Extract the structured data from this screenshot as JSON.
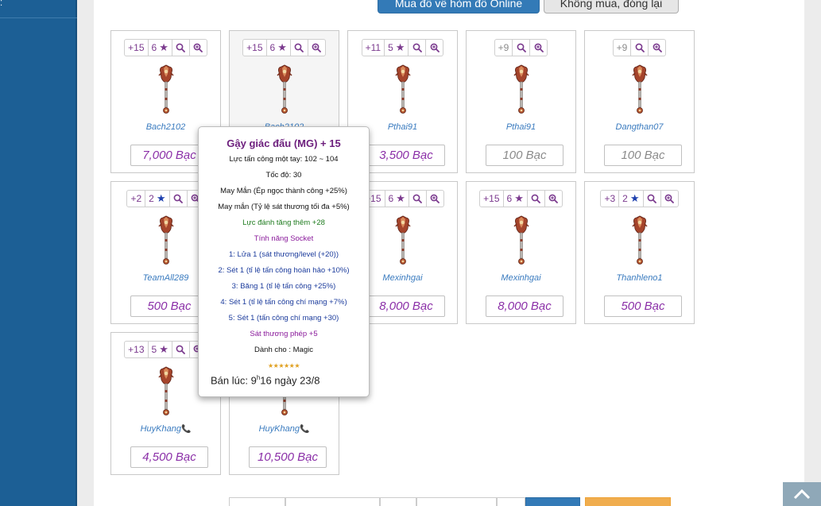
{
  "buttons": {
    "buy": "Mua đồ về hòm đồ Online",
    "cancel": "Không mua, đóng lại"
  },
  "cards": [
    {
      "plus": "+15",
      "stars": "6",
      "seller": "Bach2102",
      "price": "7,000 Bạc"
    },
    {
      "plus": "+15",
      "stars": "6",
      "seller": "Bach2102",
      "price": ""
    },
    {
      "plus": "+11",
      "stars": "5",
      "seller": "Pthai91",
      "price": "3,500 Bạc"
    },
    {
      "plus": "+9",
      "stars": "",
      "seller": "Pthai91",
      "price": "100 Bạc"
    },
    {
      "plus": "+9",
      "stars": "",
      "seller": "Dangthan07",
      "price": "100 Bạc"
    },
    {
      "plus": "+2",
      "stars": "2",
      "seller": "TeamAll289",
      "price": "500 Bạc"
    },
    {
      "plus": "",
      "stars": "",
      "seller": "",
      "price": ""
    },
    {
      "plus": "+15",
      "stars": "6",
      "seller": "Mexinhgai",
      "price": "8,000 Bạc"
    },
    {
      "plus": "+15",
      "stars": "6",
      "seller": "Mexinhgai",
      "price": "8,000 Bạc"
    },
    {
      "plus": "+3",
      "stars": "2",
      "seller": "Thanhleno1",
      "price": "500 Bạc"
    },
    {
      "plus": "+13",
      "stars": "5",
      "seller": "HuyKhang",
      "price": "4,500 Bạc"
    },
    {
      "plus": "",
      "stars": "",
      "seller": "HuyKhang",
      "price": "10,500 Bạc"
    }
  ],
  "tooltip": {
    "title": "Gậy giác đấu (MG) + 15",
    "lines": [
      "Lực tấn công một tay: 102 ~ 104",
      "Tốc độ: 30",
      "May Mắn (Ép ngọc thành công +25%)",
      "May mắn (Tỷ lệ sát thương tối đa +5%)",
      "Lực đánh tăng thêm +28",
      "Tính năng Socket",
      "1: Lửa 1 (sát thương/level (+20))",
      "2: Sét 1 (tỉ lệ tấn công hoàn hảo +10%)",
      "3: Băng 1 (tỉ lệ tấn công +25%)",
      "4: Sét 1 (tỉ lệ tấn công chí mạng +7%)",
      "5: Sét 1 (tấn công chí mạng +30)",
      "Sát thương phép +5",
      "Dành cho : Magic"
    ],
    "sold_prefix": "Bán lúc: 9",
    "sold_sup": "h",
    "sold_suffix": "16 ngày 23/8"
  },
  "colors": {
    "sidebar": "#1c5f95",
    "primary": "#337ab7",
    "price": "#8a2ea7",
    "seller": "#3a7bbf",
    "orange": "#f0ad4e"
  },
  "icons": [
    "star-icon",
    "search-icon",
    "zoom-in-icon",
    "phone-icon",
    "chevron-up-icon",
    "mace-weapon-icon"
  ]
}
